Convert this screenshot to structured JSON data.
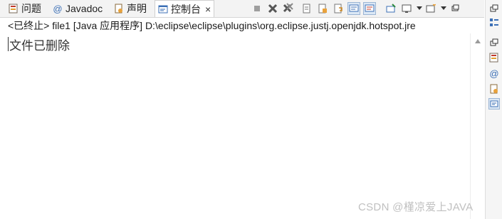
{
  "tabs": [
    {
      "label": "问题",
      "icon": "problems-icon"
    },
    {
      "label": "Javadoc",
      "icon": "javadoc-at-icon"
    },
    {
      "label": "声明",
      "icon": "declaration-icon"
    },
    {
      "label": "控制台",
      "icon": "console-icon",
      "active": true,
      "close": "×"
    }
  ],
  "console": {
    "path": "<已终止> file1 [Java 应用程序] D:\\eclipse\\eclipse\\plugins\\org.eclipse.justj.openjdk.hotspot.jre",
    "output": "文件已删除"
  },
  "toolbar_icons": [
    "terminate-icon",
    "remove-launch-icon",
    "remove-all-terminated-icon",
    "clear-console-icon",
    "scroll-lock-icon",
    "word-wrap-icon",
    "show-on-stdout-icon",
    "show-on-stderr-icon",
    "pin-console-icon",
    "display-selected-console-icon",
    "display-dropdown-icon",
    "open-console-icon",
    "open-console-dropdown-icon",
    "minimize-icon"
  ],
  "watermark": "CSDN @槿凉爱上JAVA",
  "colors": {
    "accent": "#3b6fb6",
    "selected_bg": "#dce8f5"
  }
}
